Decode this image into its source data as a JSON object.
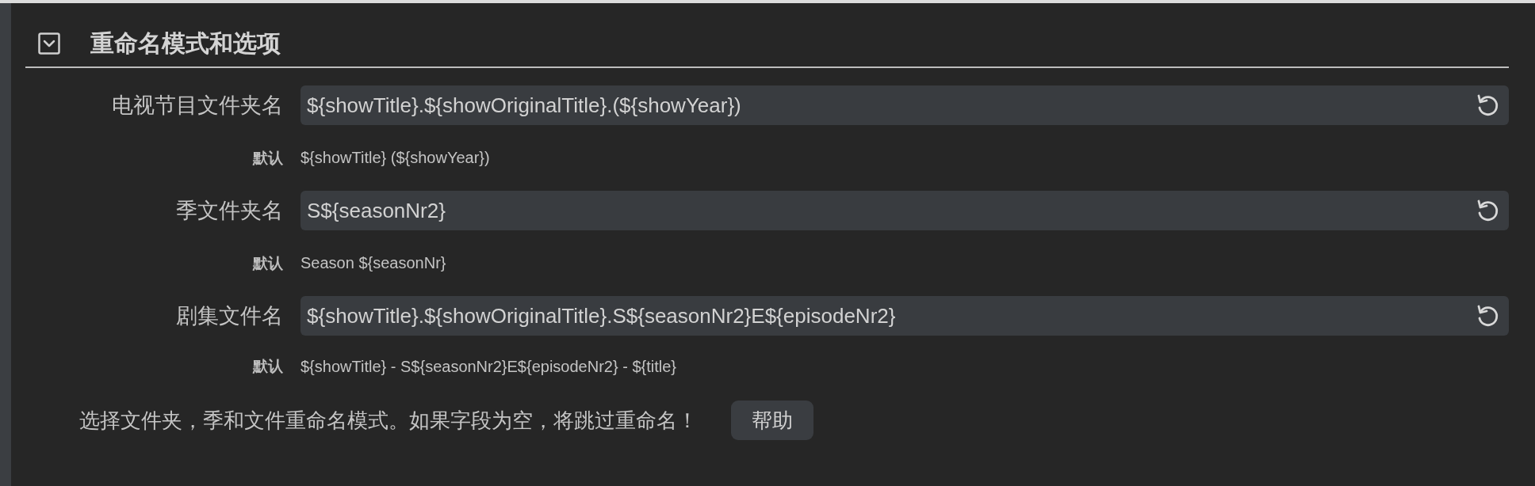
{
  "section": {
    "title": "重命名模式和选项",
    "expanded": true,
    "rows": [
      {
        "label": "电视节目文件夹名",
        "value": "${showTitle}.${showOriginalTitle}.(${showYear})",
        "default_label": "默认",
        "default_value": "${showTitle} (${showYear})"
      },
      {
        "label": "季文件夹名",
        "value": "S${seasonNr2}",
        "default_label": "默认",
        "default_value": "Season ${seasonNr}"
      },
      {
        "label": "剧集文件名",
        "value": "${showTitle}.${showOriginalTitle}.S${seasonNr2}E${episodeNr2}",
        "default_label": "默认",
        "default_value": "${showTitle} - S${seasonNr2}E${episodeNr2} - ${title}"
      }
    ],
    "hint": "选择文件夹，季和文件重命名模式。如果字段为空，将跳过重命名！",
    "help_button": "帮助"
  }
}
